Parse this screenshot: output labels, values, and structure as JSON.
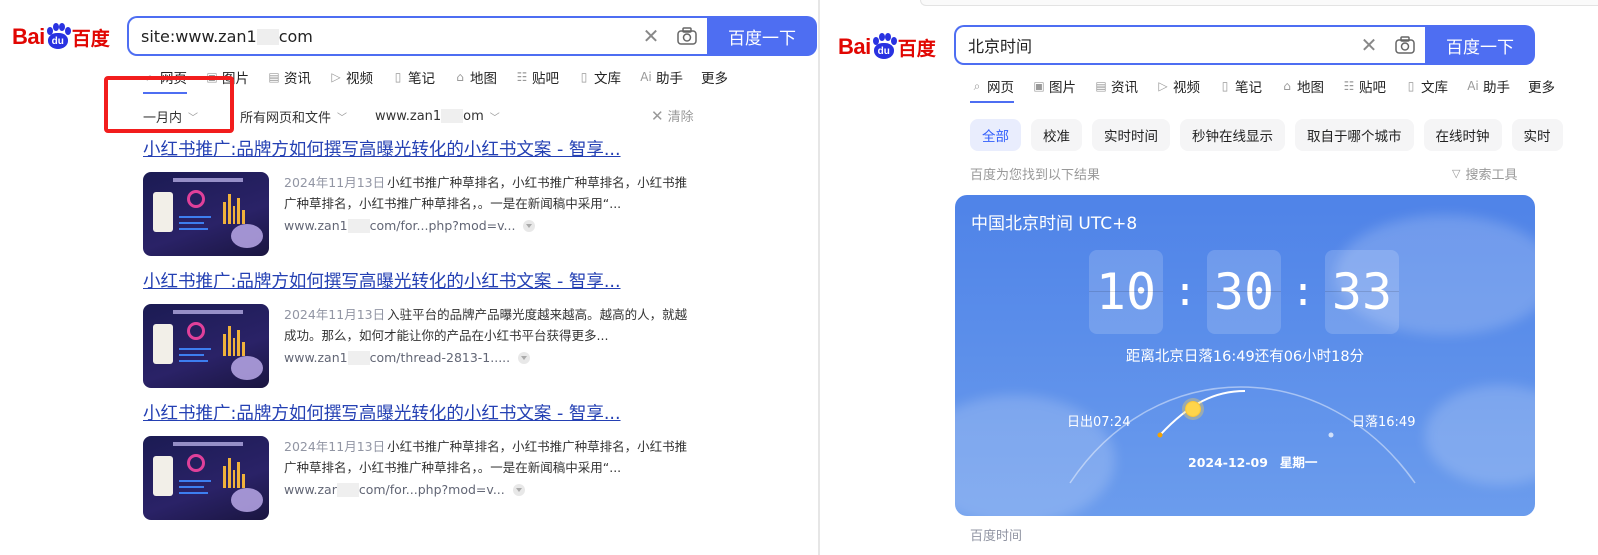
{
  "left": {
    "logo": {
      "bai": "Bai",
      "du": "du",
      "cn": "百度"
    },
    "search": {
      "query_prefix": "site:www.zan1",
      "query_suffix": "com",
      "button": "百度一下"
    },
    "tabs": [
      {
        "label": "网页",
        "icon": "search-icon",
        "glyph": "⌕"
      },
      {
        "label": "图片",
        "icon": "image-icon",
        "glyph": "▣"
      },
      {
        "label": "资讯",
        "icon": "news-icon",
        "glyph": "▤"
      },
      {
        "label": "视频",
        "icon": "video-icon",
        "glyph": "▷"
      },
      {
        "label": "笔记",
        "icon": "note-icon",
        "glyph": "▯"
      },
      {
        "label": "地图",
        "icon": "map-icon",
        "glyph": "⌂"
      },
      {
        "label": "贴吧",
        "icon": "tieba-icon",
        "glyph": "☷"
      },
      {
        "label": "文库",
        "icon": "doc-icon",
        "glyph": "▯"
      },
      {
        "label": "助手",
        "icon": "ai-icon",
        "glyph": "Ai"
      },
      {
        "label": "更多",
        "icon": "",
        "glyph": ""
      }
    ],
    "filters": {
      "time": "一月内",
      "scope": "所有网页和文件",
      "site_prefix": "www.zan1",
      "site_suffix": "om",
      "clear": "清除"
    },
    "results": [
      {
        "title": "小红书推广:品牌方如何撰写高曝光转化的小红书文案 - 智享...",
        "date": "2024年11月13日",
        "snippet": "小红书推广种草排名，小红书推广种草排名，小红书推广种草排名，小红书推广种草排名，。一是在新闻稿中采用“...",
        "url_prefix": "www.zan1",
        "url_suffix": "com/for...php?mod=v..."
      },
      {
        "title": "小红书推广:品牌方如何撰写高曝光转化的小红书文案 - 智享...",
        "date": "2024年11月13日",
        "snippet": "入驻平台的品牌产品曝光度越来越高。越高的人，就越成功。那么，如何才能让你的产品在小红书平台获得更多...",
        "url_prefix": "www.zan1",
        "url_suffix": "com/thread-2813-1....."
      },
      {
        "title": "小红书推广:品牌方如何撰写高曝光转化的小红书文案 - 智享...",
        "date": "2024年11月13日",
        "snippet": "小红书推广种草排名，小红书推广种草排名，小红书推广种草排名，小红书推广种草排名，。一是在新闻稿中采用“...",
        "url_prefix": "www.zar",
        "url_suffix": "com/for...php?mod=v..."
      }
    ]
  },
  "right": {
    "logo": {
      "bai": "Bai",
      "du": "du",
      "cn": "百度"
    },
    "search": {
      "query": "北京时间",
      "button": "百度一下"
    },
    "tabs": [
      {
        "label": "网页",
        "icon": "search-icon",
        "glyph": "⌕"
      },
      {
        "label": "图片",
        "icon": "image-icon",
        "glyph": "▣"
      },
      {
        "label": "资讯",
        "icon": "news-icon",
        "glyph": "▤"
      },
      {
        "label": "视频",
        "icon": "video-icon",
        "glyph": "▷"
      },
      {
        "label": "笔记",
        "icon": "note-icon",
        "glyph": "▯"
      },
      {
        "label": "地图",
        "icon": "map-icon",
        "glyph": "⌂"
      },
      {
        "label": "贴吧",
        "icon": "tieba-icon",
        "glyph": "☷"
      },
      {
        "label": "文库",
        "icon": "doc-icon",
        "glyph": "▯"
      },
      {
        "label": "助手",
        "icon": "ai-icon",
        "glyph": "Ai"
      },
      {
        "label": "更多",
        "icon": "",
        "glyph": ""
      }
    ],
    "chips": [
      "全部",
      "校准",
      "实时时间",
      "秒钟在线显示",
      "取自于哪个城市",
      "在线时钟",
      "实时"
    ],
    "found": "百度为您找到以下结果",
    "tools": "搜索工具",
    "card": {
      "title": "中国北京时间 UTC+8",
      "hh": "10",
      "mm": "30",
      "ss": "33",
      "sunset_note": "距离北京日落16:49还有06小时18分",
      "sunrise": "日出07:24",
      "sunset": "日落16:49",
      "date": "2024-12-09",
      "weekday": "星期一",
      "day_progress": 0.3
    },
    "footer": "百度时间"
  },
  "colors": {
    "brand_blue": "#4e6ef2",
    "logo_red": "#e10602",
    "link_blue": "#2440b3",
    "highlight_red": "#f21d1d"
  }
}
